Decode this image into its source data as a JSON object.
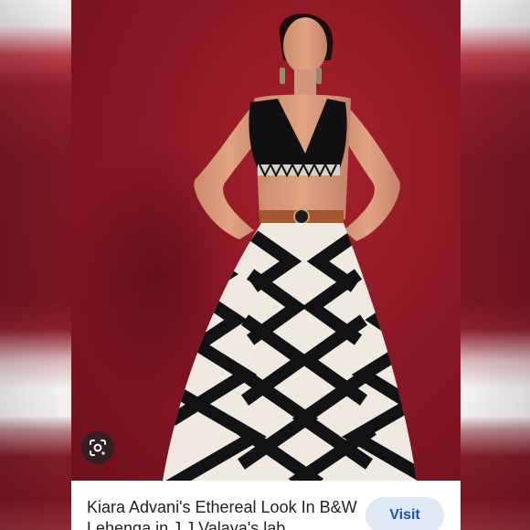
{
  "result": {
    "title": "Kiara Advani's Ethereal Look In B&W Lehenga in J J Valaya's lab",
    "visit_label": "Visit"
  },
  "icons": {
    "lens": "google-lens-icon"
  },
  "colors": {
    "backdrop": "#8b1824",
    "visit_bg": "#dfe9f8",
    "visit_text": "#1a4fb5"
  }
}
